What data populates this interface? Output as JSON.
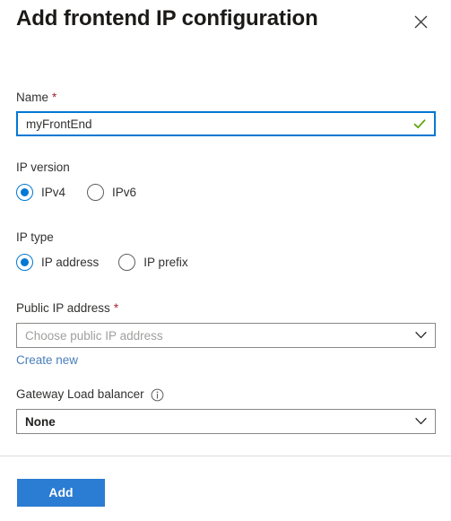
{
  "panel": {
    "title": "Add frontend IP configuration",
    "close_icon": "close-icon"
  },
  "colors": {
    "accent": "#0078d4",
    "primary_button": "#2b7cd3",
    "link": "#4a7ebb",
    "required_asterisk": "#a4262c",
    "valid_check": "#57a300",
    "placeholder_text": "#a19f9d",
    "border": "#8a8886",
    "separator": "#e1dfdd",
    "text": "#323130"
  },
  "fields": {
    "name": {
      "label": "Name",
      "required_marker": "*",
      "value": "myFrontEnd",
      "placeholder": "",
      "validation_icon": "checkmark-icon",
      "state": "valid"
    },
    "ip_version": {
      "label": "IP version",
      "options": [
        {
          "label": "IPv4",
          "selected": true
        },
        {
          "label": "IPv6",
          "selected": false
        }
      ]
    },
    "ip_type": {
      "label": "IP type",
      "options": [
        {
          "label": "IP address",
          "selected": true
        },
        {
          "label": "IP prefix",
          "selected": false
        }
      ]
    },
    "public_ip_address": {
      "label": "Public IP address",
      "required_marker": "*",
      "placeholder": "Choose public IP address",
      "value": "",
      "chevron_icon": "chevron-down-icon",
      "create_new_link": "Create new"
    },
    "gateway_load_balancer": {
      "label": "Gateway Load balancer",
      "info_icon": "info-icon",
      "value": "None",
      "chevron_icon": "chevron-down-icon"
    }
  },
  "footer": {
    "add_label": "Add"
  }
}
